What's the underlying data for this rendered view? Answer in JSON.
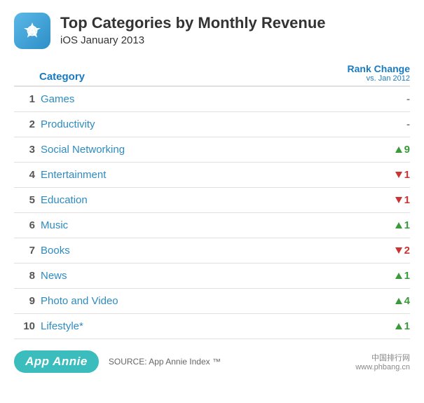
{
  "header": {
    "title": "Top Categories by Monthly Revenue",
    "subtitle": "iOS January 2013"
  },
  "table": {
    "col_category": "Category",
    "col_rank": "Rank Change",
    "col_rank_sub": "vs. Jan 2012",
    "rows": [
      {
        "rank": "1",
        "name": "Games",
        "change_type": "neutral",
        "change_val": "-"
      },
      {
        "rank": "2",
        "name": "Productivity",
        "change_type": "neutral",
        "change_val": "-"
      },
      {
        "rank": "3",
        "name": "Social Networking",
        "change_type": "up",
        "change_val": "9"
      },
      {
        "rank": "4",
        "name": "Entertainment",
        "change_type": "down",
        "change_val": "1"
      },
      {
        "rank": "5",
        "name": "Education",
        "change_type": "down",
        "change_val": "1"
      },
      {
        "rank": "6",
        "name": "Music",
        "change_type": "up",
        "change_val": "1"
      },
      {
        "rank": "7",
        "name": "Books",
        "change_type": "down",
        "change_val": "2"
      },
      {
        "rank": "8",
        "name": "News",
        "change_type": "up",
        "change_val": "1"
      },
      {
        "rank": "9",
        "name": "Photo and Video",
        "change_type": "up",
        "change_val": "4"
      },
      {
        "rank": "10",
        "name": "Lifestyle*",
        "change_type": "up",
        "change_val": "1"
      }
    ]
  },
  "footer": {
    "badge": "App Annie",
    "source": "SOURCE: App Annie Index ™",
    "watermark_line1": "中国排行网",
    "watermark_line2": "www.phbang.cn"
  }
}
